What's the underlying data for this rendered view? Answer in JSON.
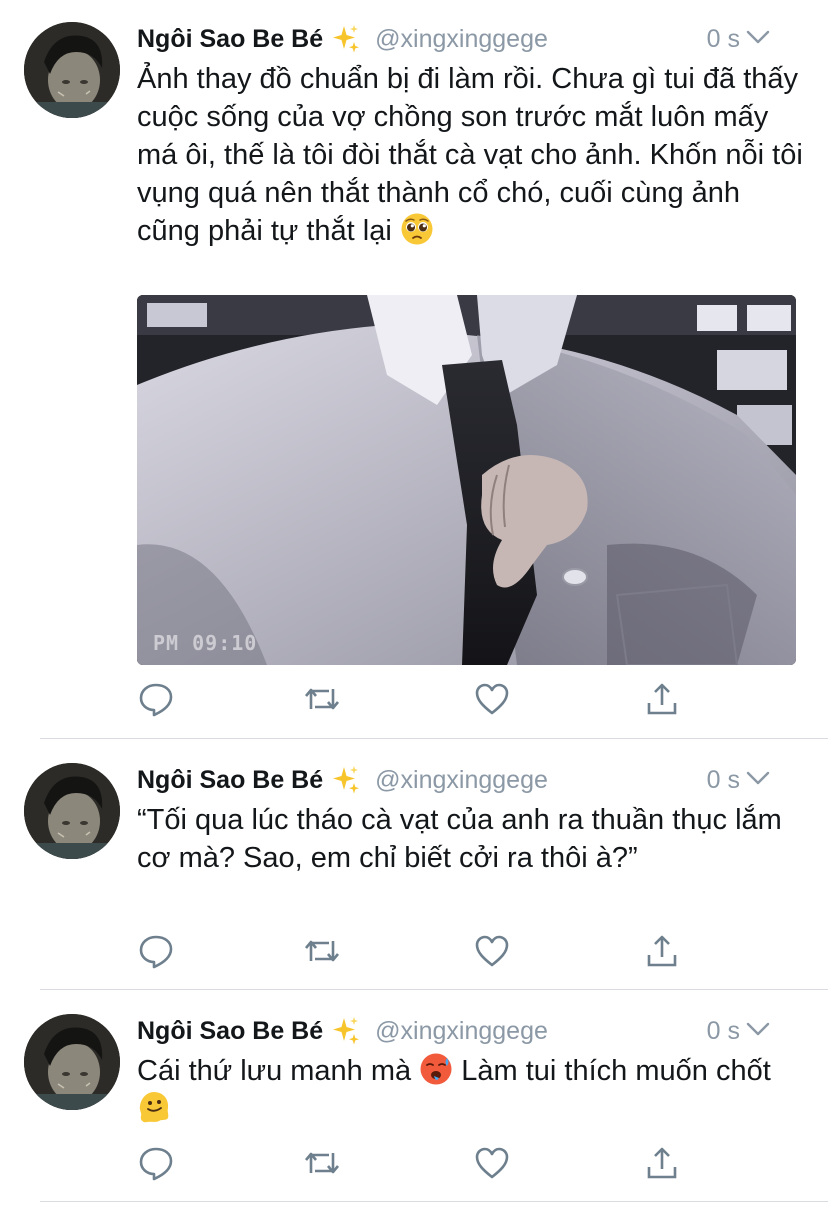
{
  "tweets": [
    {
      "author_name": "Ngôi Sao Be Bé",
      "author_emoji": "sparkles-emoji",
      "handle": "@xingxinggege",
      "time": "0 s",
      "text_parts": [
        "Ảnh thay đồ chuẩn bị đi làm rồi. Chưa gì tui đã thấy cuộc sống của vợ chồng son trước mắt luôn mấy má ôi, thế là tôi đòi thắt cà vạt cho ảnh. Khốn nỗi tôi vụng quá nên thắt thành cổ chó, cuối cùng ảnh cũng phải tự thắt lại "
      ],
      "text_emojis": [
        "pleading-face-emoji"
      ],
      "photo": {
        "overlay_text": "PM 09:10"
      }
    },
    {
      "author_name": "Ngôi Sao Be Bé",
      "author_emoji": "sparkles-emoji",
      "handle": "@xingxinggege",
      "time": "0 s",
      "text_parts": [
        "“Tối qua lúc tháo cà vạt của anh ra thuần thục lắm cơ mà? Sao, em chỉ biết cởi ra thôi à?”"
      ]
    },
    {
      "author_name": "Ngôi Sao Be Bé",
      "author_emoji": "sparkles-emoji",
      "handle": "@xingxinggege",
      "time": "0 s",
      "text_parts": [
        "Cái thứ lưu manh mà ",
        " Làm tui thích muốn chốt "
      ],
      "text_emojis": [
        "hot-face-emoji",
        "melting-face-emoji"
      ]
    }
  ],
  "icons": {
    "reply": "reply-icon",
    "retweet": "retweet-icon",
    "like": "heart-icon",
    "share": "share-icon",
    "menu": "chevron-down-icon"
  },
  "colors": {
    "text": "#14171a",
    "secondary": "#8b98a5",
    "icon": "#6e7f8d",
    "divider": "#d9dde2"
  }
}
